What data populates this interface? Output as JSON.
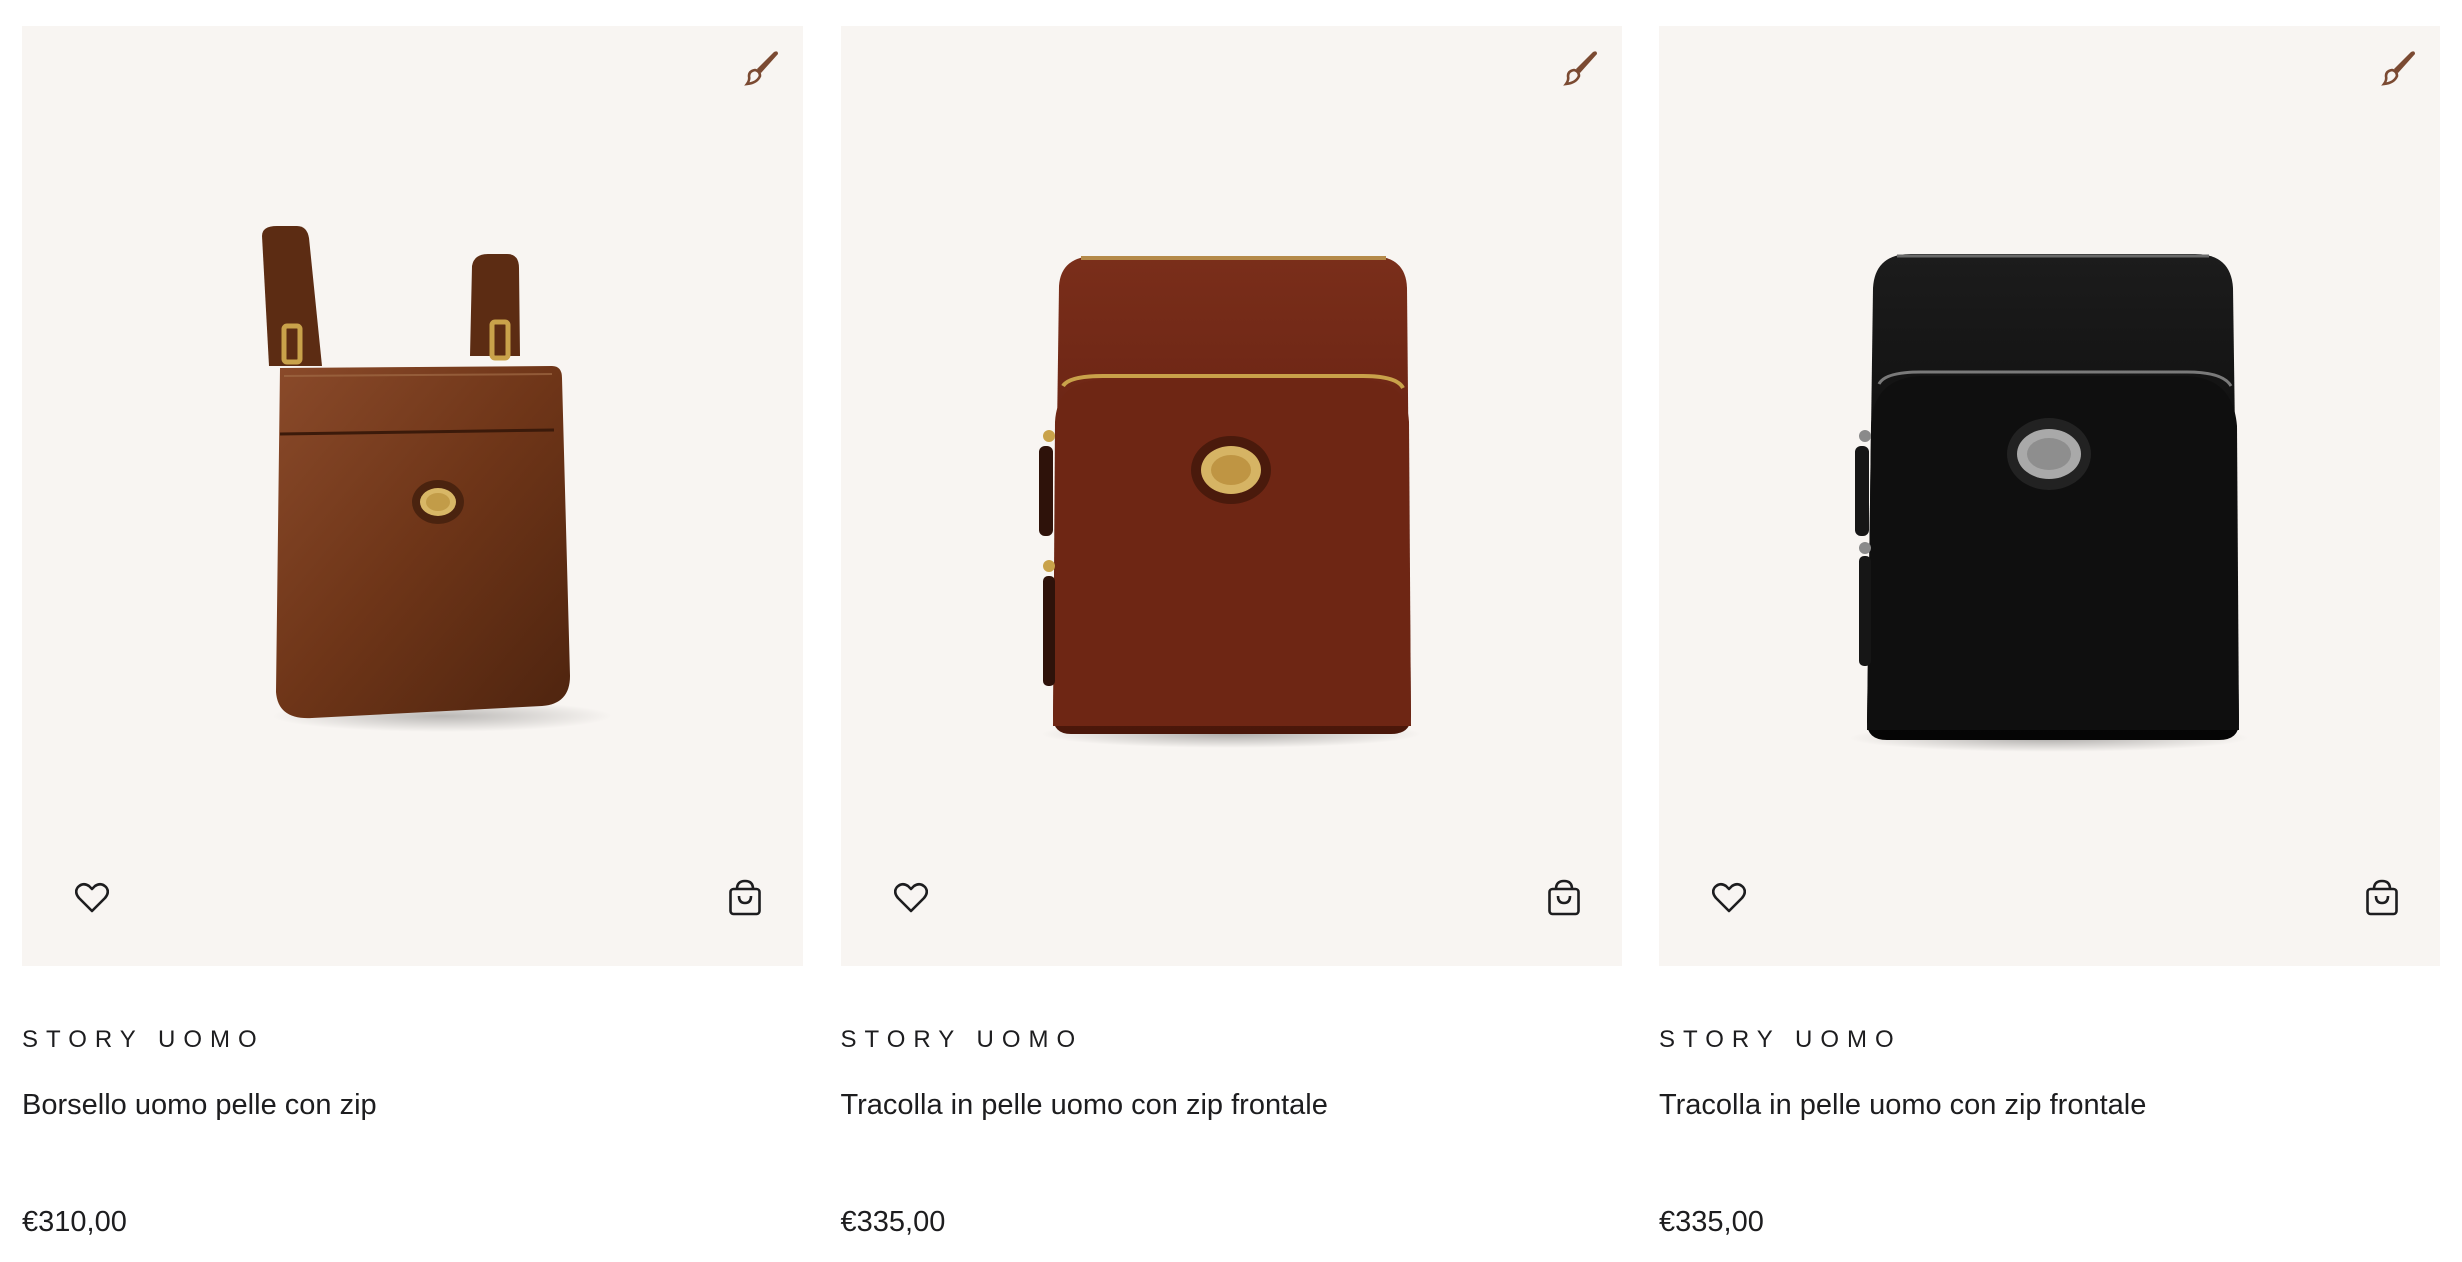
{
  "colors": {
    "card_background": "#f8f5f2",
    "icon_brown": "#7b4a32",
    "text": "#1d1d1f"
  },
  "products": [
    {
      "collection": "STORY UOMO",
      "title": "Borsello uomo pelle con zip",
      "price": "€310,00",
      "icons": {
        "customize": "paintbrush-icon",
        "wishlist": "heart-icon",
        "cart": "shopping-bag-icon"
      }
    },
    {
      "collection": "STORY UOMO",
      "title": "Tracolla in pelle uomo con zip frontale",
      "price": "€335,00",
      "icons": {
        "customize": "paintbrush-icon",
        "wishlist": "heart-icon",
        "cart": "shopping-bag-icon"
      }
    },
    {
      "collection": "STORY UOMO",
      "title": "Tracolla in pelle uomo con zip frontale",
      "price": "€335,00",
      "icons": {
        "customize": "paintbrush-icon",
        "wishlist": "heart-icon",
        "cart": "shopping-bag-icon"
      }
    }
  ]
}
